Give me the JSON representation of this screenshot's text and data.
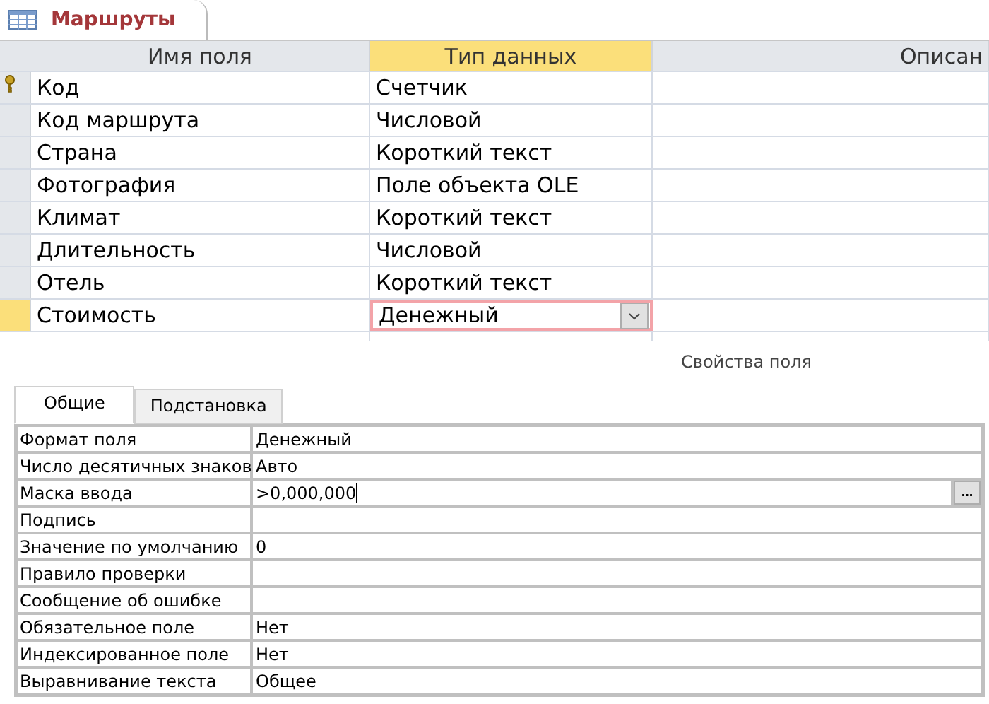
{
  "document_tab": {
    "title": "Маршруты"
  },
  "design_grid": {
    "columns": [
      {
        "label": "Имя поля",
        "selected": false
      },
      {
        "label": "Тип данных",
        "selected": true
      },
      {
        "label": "Описан",
        "selected": false
      }
    ],
    "rows": [
      {
        "field_name": "Код",
        "data_type": "Счетчик",
        "primary_key": true,
        "selected": false
      },
      {
        "field_name": "Код маршрута",
        "data_type": "Числовой",
        "primary_key": false,
        "selected": false
      },
      {
        "field_name": "Страна",
        "data_type": "Короткий текст",
        "primary_key": false,
        "selected": false
      },
      {
        "field_name": "Фотография",
        "data_type": "Поле объекта OLE",
        "primary_key": false,
        "selected": false
      },
      {
        "field_name": "Климат",
        "data_type": "Короткий текст",
        "primary_key": false,
        "selected": false
      },
      {
        "field_name": "Длительность",
        "data_type": "Числовой",
        "primary_key": false,
        "selected": false
      },
      {
        "field_name": "Отель",
        "data_type": "Короткий текст",
        "primary_key": false,
        "selected": false
      },
      {
        "field_name": "Стоимость",
        "data_type": "Денежный",
        "primary_key": false,
        "selected": true
      }
    ]
  },
  "field_properties": {
    "title": "Свойства поля",
    "tabs": [
      {
        "label": "Общие",
        "selected": true
      },
      {
        "label": "Подстановка",
        "selected": false
      }
    ],
    "properties": [
      {
        "name": "Формат поля",
        "value": "Денежный",
        "focused": false
      },
      {
        "name": "Число десятичных знаков",
        "value": "Авто",
        "focused": false
      },
      {
        "name": "Маска ввода",
        "value": ">0,000,000",
        "focused": true,
        "builder_button": "..."
      },
      {
        "name": "Подпись",
        "focused": false
      },
      {
        "name": "Значение по умолчанию",
        "value": "0",
        "focused": false
      },
      {
        "name": "Правило проверки",
        "focused": false
      },
      {
        "name": "Сообщение об ошибке",
        "focused": false
      },
      {
        "name": "Обязательное поле",
        "value": "Нет",
        "focused": false
      },
      {
        "name": "Индексированное поле",
        "value": "Нет",
        "focused": false
      },
      {
        "name": "Выравнивание текста",
        "value": "Общее",
        "focused": false
      }
    ]
  }
}
